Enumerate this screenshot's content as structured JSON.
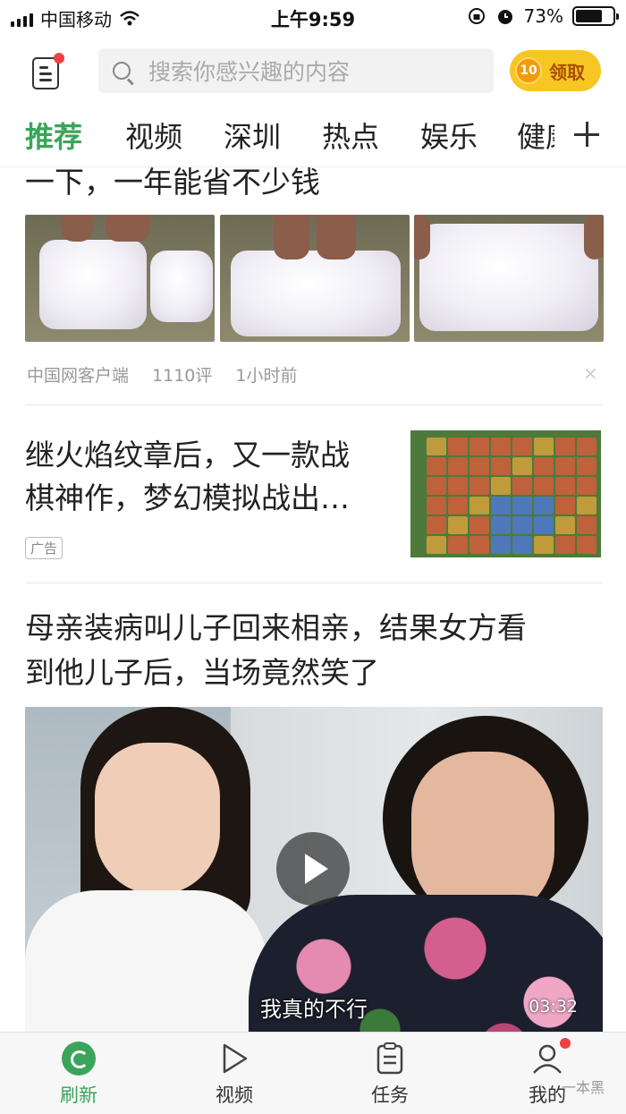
{
  "status_bar": {
    "carrier": "中国移动",
    "time": "上午9:59",
    "battery": "73%",
    "battery_level": 0.73
  },
  "header": {
    "search_placeholder": "搜索你感兴趣的内容",
    "coin_count": "10",
    "coin_label": "领取"
  },
  "tabs": [
    {
      "label": "推荐",
      "active": true
    },
    {
      "label": "视频"
    },
    {
      "label": "深圳"
    },
    {
      "label": "热点"
    },
    {
      "label": "娱乐"
    },
    {
      "label": "健康"
    }
  ],
  "feed": {
    "item1": {
      "title_partial": "一下，一年能省不少钱",
      "source": "中国网客户端",
      "comments": "1110评",
      "time": "1小时前",
      "close": "×"
    },
    "ad": {
      "title_line1": "继火焰纹章后，又一款战",
      "title_line2": "棋神作，梦幻模拟战出…",
      "badge": "广告"
    },
    "item3": {
      "title_line1": "母亲装病叫儿子回来相亲，结果女方看",
      "title_line2": "到他儿子后，当场竟然笑了",
      "subtitle": "我真的不行",
      "duration": "03:32"
    }
  },
  "bottom_nav": [
    {
      "label": "刷新",
      "icon": "refresh-icon",
      "active": true
    },
    {
      "label": "视频",
      "icon": "play-outline-icon"
    },
    {
      "label": "任务",
      "icon": "clipboard-icon"
    },
    {
      "label": "我的",
      "icon": "user-icon"
    }
  ],
  "watermark": "一本黑",
  "colors": {
    "accent": "#3aa55a",
    "badge_red": "#f04141",
    "coin_yellow": "#f7c623"
  }
}
